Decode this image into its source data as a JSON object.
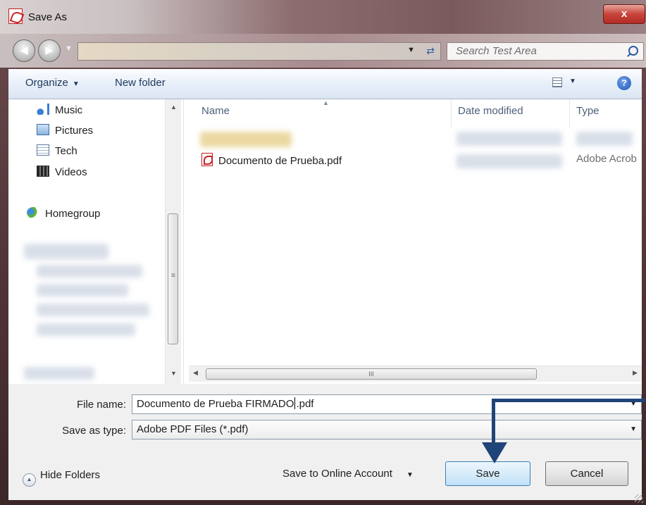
{
  "window": {
    "title": "Save As",
    "close_glyph": "x"
  },
  "navbar": {
    "search_placeholder": "Search Test Area",
    "back_icon": "back-arrow-icon",
    "forward_icon": "forward-arrow-icon"
  },
  "toolbar": {
    "organize_label": "Organize",
    "new_folder_label": "New folder",
    "help_glyph": "?"
  },
  "sidebar": {
    "items": [
      {
        "label": "Music",
        "icon": "music-icon"
      },
      {
        "label": "Pictures",
        "icon": "pictures-icon"
      },
      {
        "label": "Tech",
        "icon": "document-icon"
      },
      {
        "label": "Videos",
        "icon": "videos-icon"
      },
      {
        "label": "Homegroup",
        "icon": "homegroup-icon"
      }
    ]
  },
  "file_list": {
    "columns": {
      "name": "Name",
      "date": "Date modified",
      "type": "Type"
    },
    "rows": [
      {
        "name": "Documento de Prueba.pdf",
        "type": "Adobe Acrob"
      }
    ],
    "scroll_grip": "III"
  },
  "form": {
    "filename_label": "File name:",
    "filename_value_before": "Documento de Prueba FIRMADO",
    "filename_value_after": ".pdf",
    "type_label": "Save as type:",
    "type_value": "Adobe PDF Files (*.pdf)"
  },
  "footer": {
    "hide_folders_label": "Hide Folders",
    "online_label": "Save to Online Account",
    "save_label": "Save",
    "cancel_label": "Cancel"
  },
  "colors": {
    "annotation_arrow": "#1f4479",
    "save_button_border": "#3c7fb1"
  }
}
